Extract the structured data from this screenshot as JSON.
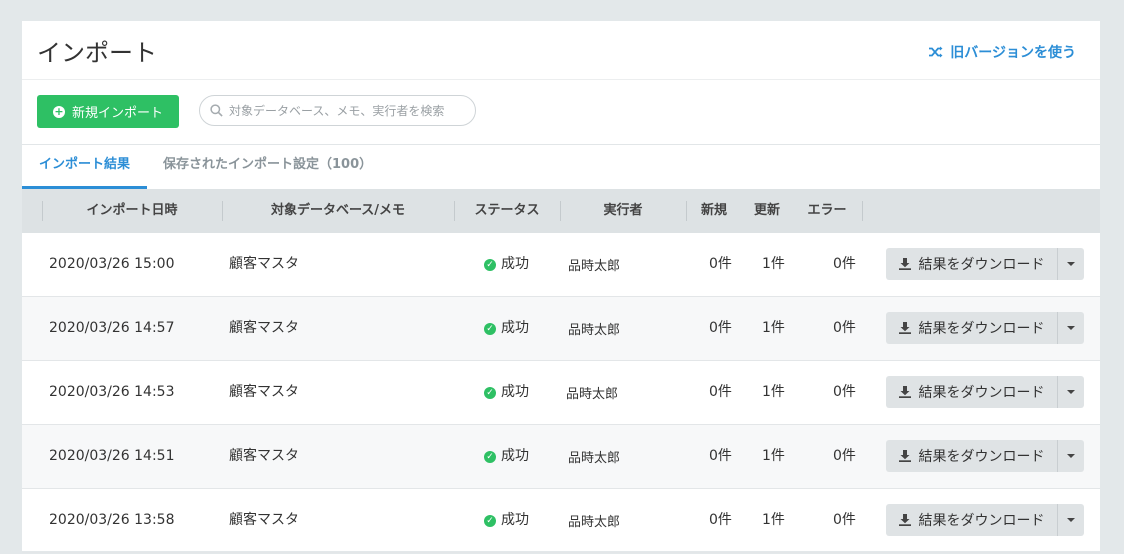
{
  "header": {
    "title": "インポート",
    "legacy_link": "旧バージョンを使う"
  },
  "toolbar": {
    "new_import_label": "新規インポート",
    "search_placeholder": "対象データベース、メモ、実行者を検索",
    "search_value": ""
  },
  "tabs": [
    {
      "label": "インポート結果",
      "active": true
    },
    {
      "label": "保存されたインポート設定（100）",
      "active": false
    }
  ],
  "table": {
    "columns": [
      "インポート日時",
      "対象データベース/メモ",
      "ステータス",
      "実行者",
      "新規",
      "更新",
      "エラー"
    ],
    "download_label": "結果をダウンロード",
    "rows": [
      {
        "date": "2020/03/26 15:00",
        "db": "顧客マスタ",
        "status": "成功",
        "user": "品時太郎",
        "new": "0件",
        "updated": "1件",
        "error": "0件"
      },
      {
        "date": "2020/03/26 14:57",
        "db": "顧客マスタ",
        "status": "成功",
        "user": "品時太郎",
        "new": "0件",
        "updated": "1件",
        "error": "0件"
      },
      {
        "date": "2020/03/26 14:53",
        "db": "顧客マスタ",
        "status": "成功",
        "user": "品時太郎",
        "new": "0件",
        "updated": "1件",
        "error": "0件"
      },
      {
        "date": "2020/03/26 14:51",
        "db": "顧客マスタ",
        "status": "成功",
        "user": "品時太郎",
        "new": "0件",
        "updated": "1件",
        "error": "0件"
      },
      {
        "date": "2020/03/26 13:58",
        "db": "顧客マスタ",
        "status": "成功",
        "user": "品時太郎",
        "new": "0件",
        "updated": "1件",
        "error": "0件"
      }
    ]
  },
  "colors": {
    "accent": "#2c8ed6",
    "success": "#2ec064",
    "header_bg": "#dde2e4"
  }
}
